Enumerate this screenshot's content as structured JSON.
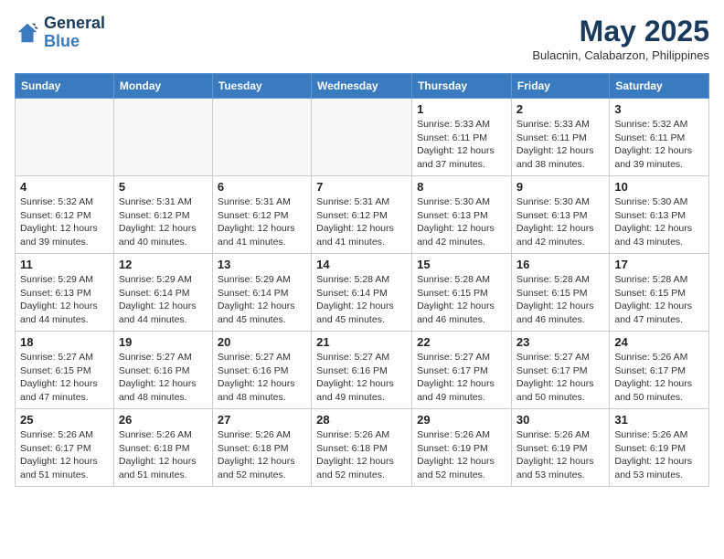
{
  "logo": {
    "line1": "General",
    "line2": "Blue"
  },
  "title": "May 2025",
  "subtitle": "Bulacnin, Calabarzon, Philippines",
  "weekdays": [
    "Sunday",
    "Monday",
    "Tuesday",
    "Wednesday",
    "Thursday",
    "Friday",
    "Saturday"
  ],
  "weeks": [
    [
      {
        "day": "",
        "info": ""
      },
      {
        "day": "",
        "info": ""
      },
      {
        "day": "",
        "info": ""
      },
      {
        "day": "",
        "info": ""
      },
      {
        "day": "1",
        "info": "Sunrise: 5:33 AM\nSunset: 6:11 PM\nDaylight: 12 hours and 37 minutes."
      },
      {
        "day": "2",
        "info": "Sunrise: 5:33 AM\nSunset: 6:11 PM\nDaylight: 12 hours and 38 minutes."
      },
      {
        "day": "3",
        "info": "Sunrise: 5:32 AM\nSunset: 6:11 PM\nDaylight: 12 hours and 39 minutes."
      }
    ],
    [
      {
        "day": "4",
        "info": "Sunrise: 5:32 AM\nSunset: 6:12 PM\nDaylight: 12 hours and 39 minutes."
      },
      {
        "day": "5",
        "info": "Sunrise: 5:31 AM\nSunset: 6:12 PM\nDaylight: 12 hours and 40 minutes."
      },
      {
        "day": "6",
        "info": "Sunrise: 5:31 AM\nSunset: 6:12 PM\nDaylight: 12 hours and 41 minutes."
      },
      {
        "day": "7",
        "info": "Sunrise: 5:31 AM\nSunset: 6:12 PM\nDaylight: 12 hours and 41 minutes."
      },
      {
        "day": "8",
        "info": "Sunrise: 5:30 AM\nSunset: 6:13 PM\nDaylight: 12 hours and 42 minutes."
      },
      {
        "day": "9",
        "info": "Sunrise: 5:30 AM\nSunset: 6:13 PM\nDaylight: 12 hours and 42 minutes."
      },
      {
        "day": "10",
        "info": "Sunrise: 5:30 AM\nSunset: 6:13 PM\nDaylight: 12 hours and 43 minutes."
      }
    ],
    [
      {
        "day": "11",
        "info": "Sunrise: 5:29 AM\nSunset: 6:13 PM\nDaylight: 12 hours and 44 minutes."
      },
      {
        "day": "12",
        "info": "Sunrise: 5:29 AM\nSunset: 6:14 PM\nDaylight: 12 hours and 44 minutes."
      },
      {
        "day": "13",
        "info": "Sunrise: 5:29 AM\nSunset: 6:14 PM\nDaylight: 12 hours and 45 minutes."
      },
      {
        "day": "14",
        "info": "Sunrise: 5:28 AM\nSunset: 6:14 PM\nDaylight: 12 hours and 45 minutes."
      },
      {
        "day": "15",
        "info": "Sunrise: 5:28 AM\nSunset: 6:15 PM\nDaylight: 12 hours and 46 minutes."
      },
      {
        "day": "16",
        "info": "Sunrise: 5:28 AM\nSunset: 6:15 PM\nDaylight: 12 hours and 46 minutes."
      },
      {
        "day": "17",
        "info": "Sunrise: 5:28 AM\nSunset: 6:15 PM\nDaylight: 12 hours and 47 minutes."
      }
    ],
    [
      {
        "day": "18",
        "info": "Sunrise: 5:27 AM\nSunset: 6:15 PM\nDaylight: 12 hours and 47 minutes."
      },
      {
        "day": "19",
        "info": "Sunrise: 5:27 AM\nSunset: 6:16 PM\nDaylight: 12 hours and 48 minutes."
      },
      {
        "day": "20",
        "info": "Sunrise: 5:27 AM\nSunset: 6:16 PM\nDaylight: 12 hours and 48 minutes."
      },
      {
        "day": "21",
        "info": "Sunrise: 5:27 AM\nSunset: 6:16 PM\nDaylight: 12 hours and 49 minutes."
      },
      {
        "day": "22",
        "info": "Sunrise: 5:27 AM\nSunset: 6:17 PM\nDaylight: 12 hours and 49 minutes."
      },
      {
        "day": "23",
        "info": "Sunrise: 5:27 AM\nSunset: 6:17 PM\nDaylight: 12 hours and 50 minutes."
      },
      {
        "day": "24",
        "info": "Sunrise: 5:26 AM\nSunset: 6:17 PM\nDaylight: 12 hours and 50 minutes."
      }
    ],
    [
      {
        "day": "25",
        "info": "Sunrise: 5:26 AM\nSunset: 6:17 PM\nDaylight: 12 hours and 51 minutes."
      },
      {
        "day": "26",
        "info": "Sunrise: 5:26 AM\nSunset: 6:18 PM\nDaylight: 12 hours and 51 minutes."
      },
      {
        "day": "27",
        "info": "Sunrise: 5:26 AM\nSunset: 6:18 PM\nDaylight: 12 hours and 52 minutes."
      },
      {
        "day": "28",
        "info": "Sunrise: 5:26 AM\nSunset: 6:18 PM\nDaylight: 12 hours and 52 minutes."
      },
      {
        "day": "29",
        "info": "Sunrise: 5:26 AM\nSunset: 6:19 PM\nDaylight: 12 hours and 52 minutes."
      },
      {
        "day": "30",
        "info": "Sunrise: 5:26 AM\nSunset: 6:19 PM\nDaylight: 12 hours and 53 minutes."
      },
      {
        "day": "31",
        "info": "Sunrise: 5:26 AM\nSunset: 6:19 PM\nDaylight: 12 hours and 53 minutes."
      }
    ]
  ]
}
